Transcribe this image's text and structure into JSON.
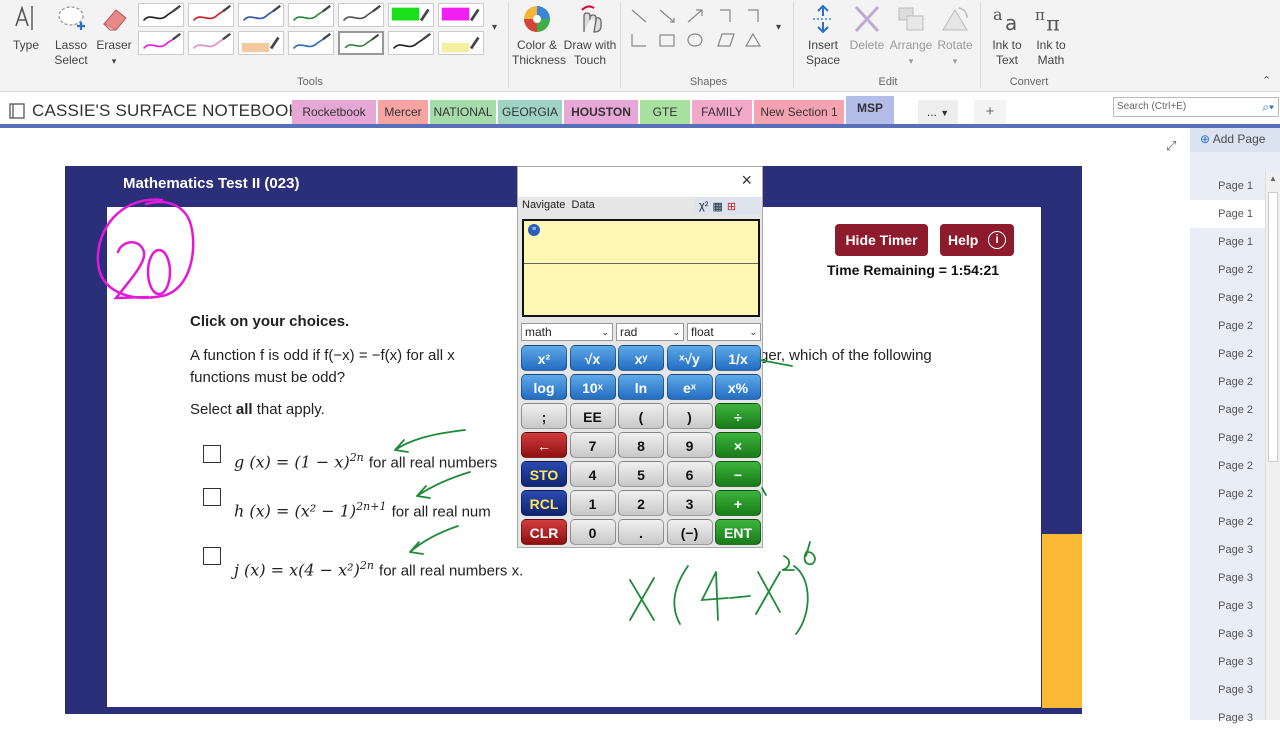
{
  "ribbon": {
    "type_label": "Type",
    "lasso_label_1": "Lasso",
    "lasso_label_2": "Select",
    "eraser_label": "Eraser",
    "tools_group": "Tools",
    "color_label_1": "Color &",
    "color_label_2": "Thickness",
    "draw_touch_1": "Draw with",
    "draw_touch_2": "Touch",
    "shapes_group": "Shapes",
    "insert_space_1": "Insert",
    "insert_space_2": "Space",
    "delete_label": "Delete",
    "arrange_label": "Arrange",
    "rotate_label": "Rotate",
    "edit_group": "Edit",
    "ink_text_1": "Ink to",
    "ink_text_2": "Text",
    "ink_math_1": "Ink to",
    "ink_math_2": "Math",
    "convert_group": "Convert",
    "pen_colors_row1": [
      "#222222",
      "#d0202a",
      "#2a5aa8",
      "#2a8a3a",
      "#555555",
      "#19e019",
      "#f11ff1"
    ],
    "pen_colors_row2": [
      "#e51ae5",
      "#e58fc8",
      "#f5c9a0",
      "#2a6fb0",
      "#2a7a3a",
      "#222222",
      "#f5f0a0"
    ]
  },
  "notebook": {
    "title": "CASSIE'S SURFACE NOTEBOOK",
    "tabs": [
      {
        "label": "Rocketbook",
        "color": "#e6a7d4"
      },
      {
        "label": "Mercer",
        "color": "#f5a3a3"
      },
      {
        "label": "NATIONAL",
        "color": "#a6dcaa"
      },
      {
        "label": "GEORGIA",
        "color": "#9fd3c4"
      },
      {
        "label": "HOUSTON",
        "color": "#e7a8d8"
      },
      {
        "label": "GTE",
        "color": "#a8e0a0"
      },
      {
        "label": "FAMILY",
        "color": "#f2a8c8"
      },
      {
        "label": "New Section 1",
        "color": "#f5a3b0"
      },
      {
        "label": "MSP",
        "color": "#b3bde8"
      }
    ],
    "more_label": "...",
    "add_tab": "+",
    "search_placeholder": "Search (Ctrl+E)"
  },
  "pages": {
    "add_label": "Add Page",
    "items": [
      "Page 1",
      "Page 1",
      "Page 1",
      "Page 2",
      "Page 2",
      "Page 2",
      "Page 2",
      "Page 2",
      "Page 2",
      "Page 2",
      "Page 2",
      "Page 2",
      "Page 2",
      "Page 3",
      "Page 3",
      "Page 3",
      "Page 3",
      "Page 3",
      "Page 3",
      "Page 3"
    ]
  },
  "test": {
    "header": "Mathematics Test II (023)",
    "hide_timer": "Hide Timer",
    "help": "Help",
    "time_remaining": "Time Remaining = 1:54:21",
    "instruction": "Click on your choices.",
    "question_line1": "A function f is odd if f(−x) = −f(x) for all x",
    "question_line1b": "ger, which of the following",
    "question_line2": "functions must be odd?",
    "select_pre": "Select ",
    "select_bold": "all",
    "select_post": " that apply.",
    "options": [
      {
        "math": "g (x) = (1 − x)",
        "exp": "2n",
        "tail": "for all real numbers"
      },
      {
        "math": "h (x) = (x² − 1)",
        "exp": "2n+1",
        "tail": "for all real num"
      },
      {
        "math": "j (x) = x(4 − x²)",
        "exp": "2n",
        "tail": "for all real numbers x."
      }
    ],
    "annotation": "20"
  },
  "calculator": {
    "close": "×",
    "menu_navigate": "Navigate",
    "menu_data": "Data",
    "drop1": "math",
    "drop2": "rad",
    "drop3": "float",
    "keys": [
      [
        "x²",
        "√x",
        "xʸ",
        "ˣ√y",
        "1/x"
      ],
      [
        "log",
        "10ˣ",
        "ln",
        "eˣ",
        "x%"
      ],
      [
        ";",
        "EE",
        "(",
        ")",
        "÷"
      ],
      [
        "←",
        "7",
        "8",
        "9",
        "×"
      ],
      [
        "STO",
        "4",
        "5",
        "6",
        "−"
      ],
      [
        "RCL",
        "1",
        "2",
        "3",
        "+"
      ],
      [
        "CLR",
        "0",
        ".",
        "(−)",
        "ENT"
      ]
    ]
  }
}
